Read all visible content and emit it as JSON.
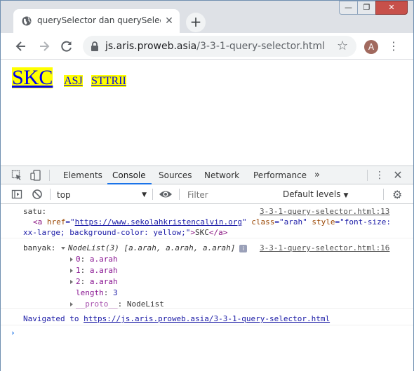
{
  "window": {
    "controls": {
      "minimize": "—",
      "maximize": "❐",
      "close": "✕"
    }
  },
  "tab": {
    "title": "querySelector dan querySelectorAll",
    "close": "✕",
    "new_tab": "+"
  },
  "address_bar": {
    "host": "js.aris.proweb.asia",
    "path": "/3-3-1-query-selector.html"
  },
  "profile": {
    "initial": "A"
  },
  "page": {
    "links": [
      {
        "text": "SKC"
      },
      {
        "text": "ASJ"
      },
      {
        "text": "STTRII"
      }
    ]
  },
  "devtools": {
    "tabs": [
      "Elements",
      "Console",
      "Sources",
      "Network",
      "Performance"
    ],
    "active_tab": "Console",
    "more": "»",
    "context": "top",
    "filter_placeholder": "Filter",
    "levels": "Default levels",
    "log": {
      "entry1": {
        "label": "satu:",
        "source": "3-3-1-query-selector.html:13",
        "tag_open": "<a",
        "href_attr": " href",
        "href_eq": "=\"",
        "href_val": "https://www.sekolahkristencalvin.org",
        "href_close": "\"",
        "class_attr": " class",
        "class_val": "=\"arah\"",
        "style_attr": " style",
        "style_val_1": "=\"font-size:",
        "style_val_2": "xx-large; background-color: yellow;\"",
        "tag_close": ">",
        "text": "SKC",
        "end_tag": "</a>"
      },
      "entry2": {
        "label": "banyak:",
        "source": "3-3-1-query-selector.html:16",
        "summary": "NodeList(3) [a.arah, a.arah, a.arah]",
        "info": "i",
        "items": [
          {
            "key": "0",
            "value": "a.arah"
          },
          {
            "key": "1",
            "value": "a.arah"
          },
          {
            "key": "2",
            "value": "a.arah"
          }
        ],
        "length_key": "length",
        "length_value": "3",
        "proto_key": "__proto__",
        "proto_value": "NodeList"
      },
      "entry3": {
        "prefix": "Navigated to",
        "url": "https://js.aris.proweb.asia/3-3-1-query-selector.html"
      },
      "prompt": "›"
    }
  },
  "colors": {
    "link_bg": "#ffff00",
    "link": "#0000ee",
    "accent": "#1a73e8"
  }
}
